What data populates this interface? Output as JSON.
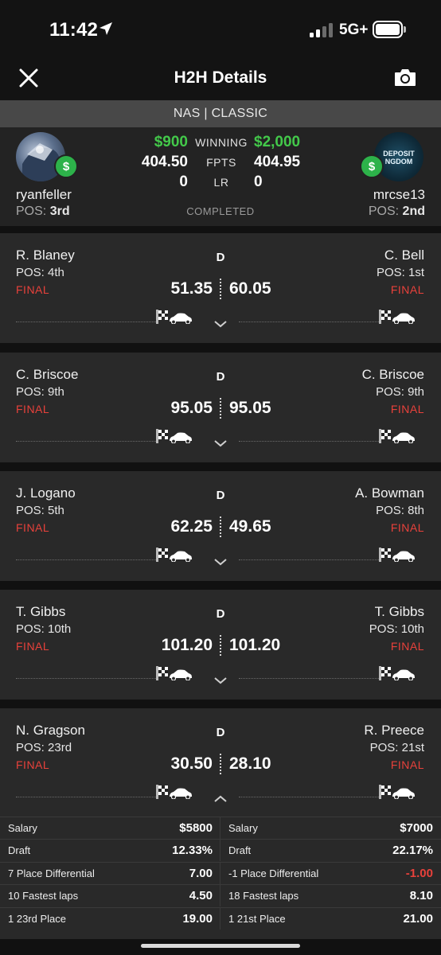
{
  "status_bar": {
    "time": "11:42",
    "network": "5G+"
  },
  "nav": {
    "title": "H2H Details",
    "close_icon": "close-icon",
    "camera_icon": "camera-icon"
  },
  "contest": {
    "label": "NAS | CLASSIC"
  },
  "summary": {
    "left_user": {
      "name": "ryanfeller",
      "pos_label": "POS:",
      "pos_value": "3rd",
      "winning": "$900",
      "fpts": "404.50",
      "lr": "0"
    },
    "right_user": {
      "name": "mrcse13",
      "pos_label": "POS:",
      "pos_value": "2nd",
      "winning": "$2,000",
      "fpts": "404.95",
      "lr": "0",
      "avatar_text": "DEPOSIT\nNGDOM"
    },
    "winning_label": "WINNING",
    "fpts_label": "FPTS",
    "lr_label": "LR",
    "status": "COMPLETED",
    "badge_symbol": "$"
  },
  "matchups": [
    {
      "left_name": "R. Blaney",
      "left_pos": "POS: 4th",
      "left_status": "FINAL",
      "left_score": "51.35",
      "position": "D",
      "right_name": "C. Bell",
      "right_pos": "POS: 1st",
      "right_status": "FINAL",
      "right_score": "60.05"
    },
    {
      "left_name": "C. Briscoe",
      "left_pos": "POS: 9th",
      "left_status": "FINAL",
      "left_score": "95.05",
      "position": "D",
      "right_name": "C. Briscoe",
      "right_pos": "POS: 9th",
      "right_status": "FINAL",
      "right_score": "95.05"
    },
    {
      "left_name": "J. Logano",
      "left_pos": "POS: 5th",
      "left_status": "FINAL",
      "left_score": "62.25",
      "position": "D",
      "right_name": "A. Bowman",
      "right_pos": "POS: 8th",
      "right_status": "FINAL",
      "right_score": "49.65"
    },
    {
      "left_name": "T. Gibbs",
      "left_pos": "POS: 10th",
      "left_status": "FINAL",
      "left_score": "101.20",
      "position": "D",
      "right_name": "T. Gibbs",
      "right_pos": "POS: 10th",
      "right_status": "FINAL",
      "right_score": "101.20"
    },
    {
      "left_name": "N. Gragson",
      "left_pos": "POS: 23rd",
      "left_status": "FINAL",
      "left_score": "30.50",
      "position": "D",
      "right_name": "R. Preece",
      "right_pos": "POS: 21st",
      "right_status": "FINAL",
      "right_score": "28.10"
    }
  ],
  "expanded_stats": [
    {
      "left_label": "Salary",
      "left_value": "$5800",
      "right_label": "Salary",
      "right_value": "$7000"
    },
    {
      "left_label": "Draft",
      "left_value": "12.33%",
      "right_label": "Draft",
      "right_value": "22.17%"
    },
    {
      "left_label": "7 Place Differential",
      "left_value": "7.00",
      "right_label": "-1 Place Differential",
      "right_value": "-1.00"
    },
    {
      "left_label": "10 Fastest laps",
      "left_value": "4.50",
      "right_label": "18 Fastest laps",
      "right_value": "8.10"
    },
    {
      "left_label": "1 23rd Place",
      "left_value": "19.00",
      "right_label": "1 21st Place",
      "right_value": "21.00"
    }
  ],
  "colors": {
    "accent_green": "#43c94a",
    "final_red": "#e8413b",
    "background": "#111111",
    "card": "#292929"
  }
}
